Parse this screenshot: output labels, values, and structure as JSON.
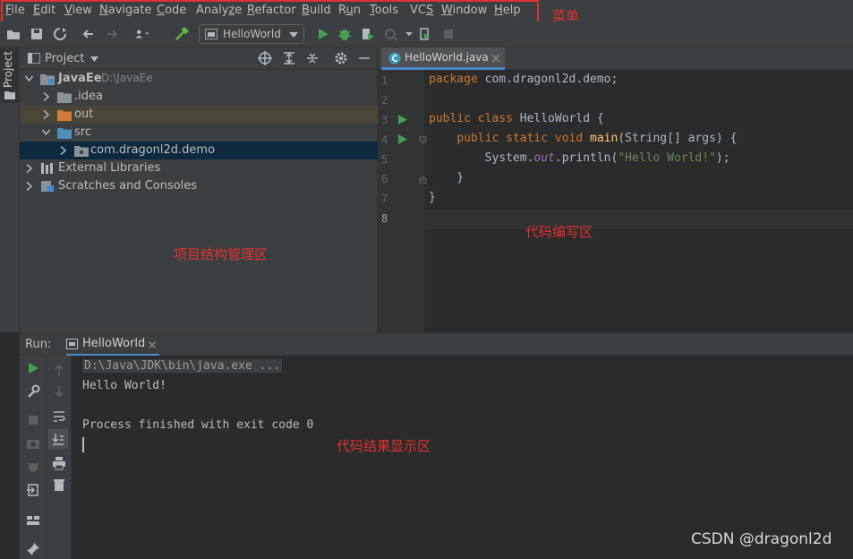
{
  "menu": {
    "items": [
      {
        "pre": "",
        "ul": "F",
        "post": "ile"
      },
      {
        "pre": "",
        "ul": "E",
        "post": "dit"
      },
      {
        "pre": "",
        "ul": "V",
        "post": "iew"
      },
      {
        "pre": "",
        "ul": "N",
        "post": "avigate"
      },
      {
        "pre": "",
        "ul": "C",
        "post": "ode"
      },
      {
        "pre": "Analy",
        "ul": "z",
        "post": "e"
      },
      {
        "pre": "",
        "ul": "R",
        "post": "efactor"
      },
      {
        "pre": "",
        "ul": "B",
        "post": "uild"
      },
      {
        "pre": "R",
        "ul": "u",
        "post": "n"
      },
      {
        "pre": "",
        "ul": "T",
        "post": "ools"
      },
      {
        "pre": "VC",
        "ul": "S",
        "post": ""
      },
      {
        "pre": "",
        "ul": "W",
        "post": "indow"
      },
      {
        "pre": "",
        "ul": "H",
        "post": "elp"
      }
    ]
  },
  "annotations": {
    "menu": "菜单",
    "project": "项目结构管理区",
    "editor": "代码编写区",
    "console": "代码结果显示区"
  },
  "toolbar": {
    "run_config": "HelloWorld"
  },
  "left_strip": {
    "project_tab": "Project"
  },
  "project_panel": {
    "title": "Project",
    "tree": [
      {
        "name": "JavaEe",
        "path": "D:\\JavaEe"
      },
      {
        "name": ".idea"
      },
      {
        "name": "out"
      },
      {
        "name": "src"
      },
      {
        "name": "com.dragonl2d.demo"
      },
      {
        "name": "External Libraries"
      },
      {
        "name": "Scratches and Consoles"
      }
    ]
  },
  "editor": {
    "tab": "HelloWorld.java",
    "line_numbers": [
      "1",
      "2",
      "3",
      "4",
      "5",
      "6",
      "7",
      "8"
    ]
  },
  "run_panel": {
    "label": "Run:",
    "tab": "HelloWorld",
    "lines": [
      "D:\\Java\\JDK\\bin\\java.exe ...",
      "Hello World!",
      "",
      "Process finished with exit code 0"
    ]
  },
  "watermark": "CSDN @dragonl2d",
  "colors": {
    "annotation": "#e03131",
    "keyword": "#cc7832",
    "function": "#ffc66d",
    "string": "#6a8759",
    "field": "#9876aa",
    "run_green": "#499c54"
  }
}
